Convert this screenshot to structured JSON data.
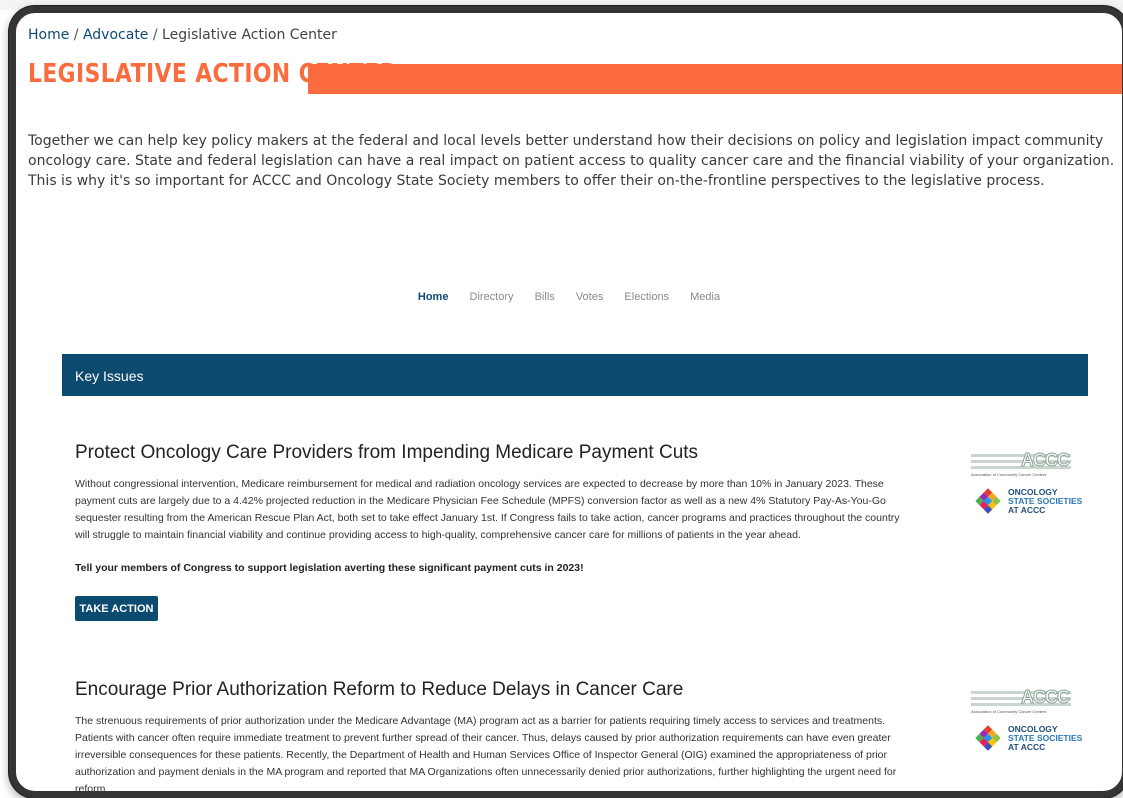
{
  "breadcrumb": {
    "home": "Home",
    "advocate": "Advocate",
    "current": "Legislative Action Center",
    "separator": "/"
  },
  "page_title": "LEGISLATIVE ACTION CENTER",
  "intro_text": "Together we can help key policy makers at the federal and local levels better understand how their decisions on policy and legislation impact community oncology care. State and federal legislation can have a real impact on patient access to quality cancer care and the financial viability of your organization. This is why it's so important for ACCC and Oncology State Society members to offer their on-the-frontline perspectives to the legislative process.",
  "subnav": {
    "items": [
      "Home",
      "Directory",
      "Bills",
      "Votes",
      "Elections",
      "Media"
    ],
    "active": "Home"
  },
  "key_issues_label": "Key Issues",
  "issues": [
    {
      "title": "Protect Oncology Care Providers from Impending Medicare Payment Cuts",
      "body": "Without congressional intervention, Medicare reimbursement for medical and radiation oncology services are expected to decrease by more than 10% in January 2023. These payment cuts are largely due to a 4.42% projected reduction in the Medicare Physician Fee Schedule (MPFS) conversion factor as well as a new 4% Statutory Pay-As-You-Go sequester resulting from the American Rescue Plan Act, both set to take effect January 1st. If Congress fails to take action, cancer programs and practices throughout the country will struggle to maintain financial viability and continue providing access to high-quality, comprehensive cancer care for millions of patients in the year ahead.",
      "cta": "Tell your members of Congress to support legislation averting these significant payment cuts in 2023!",
      "button_label": "TAKE ACTION"
    },
    {
      "title": "Encourage Prior Authorization Reform to Reduce Delays in Cancer Care",
      "body": "The strenuous requirements of prior authorization under the Medicare Advantage (MA) program act as a barrier for patients requiring timely access to services and treatments. Patients with cancer often require immediate treatment to prevent further spread of their cancer. Thus, delays caused by prior authorization requirements can have even greater irreversible consequences for these patients. Recently, the Department of Health and Human Services Office of Inspector General (OIG) examined the appropriateness of prior authorization and payment denials in the MA program and reported that MA Organizations often unnecessarily denied prior authorizations, further highlighting the urgent need for reform."
    }
  ],
  "logos": {
    "accc": "ACCC",
    "accc_sub": "Association of Community Cancer Centers",
    "oss_line1": "ONCOLOGY",
    "oss_line2": "STATE SOCIETIES",
    "oss_line3": "AT ACCC"
  },
  "colors": {
    "accent_orange": "#fb6b3d",
    "navy": "#0c4a70",
    "link_blue": "#0e4a73"
  }
}
